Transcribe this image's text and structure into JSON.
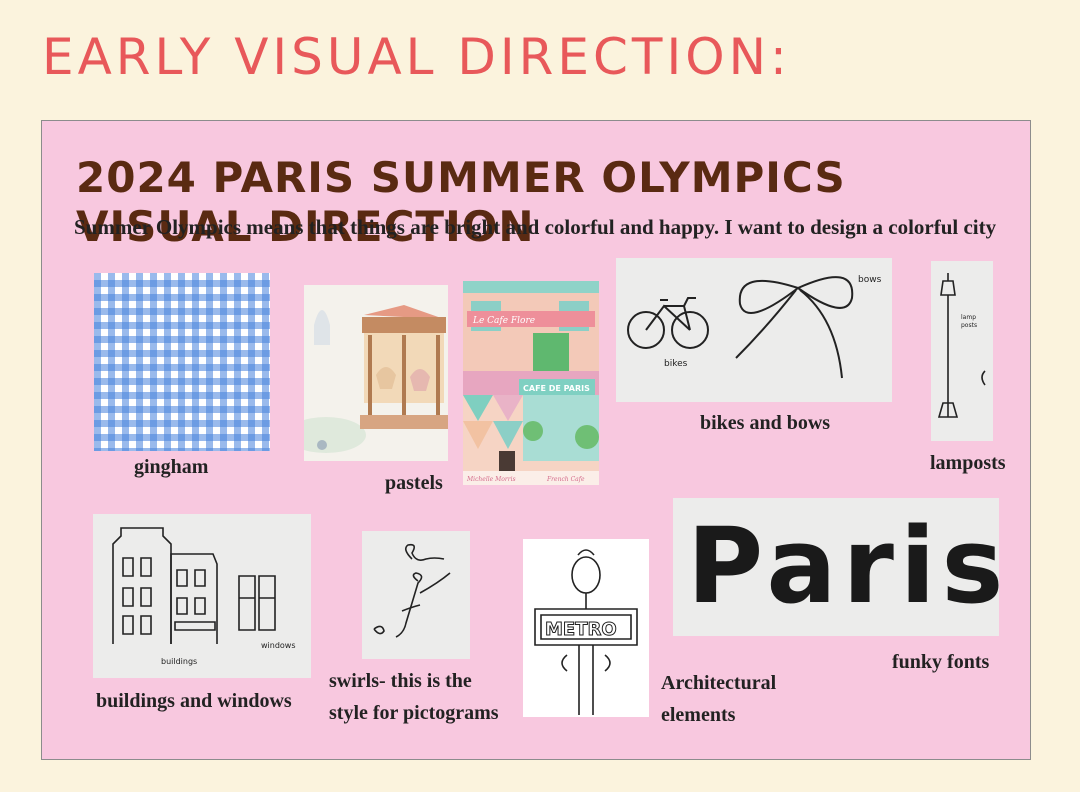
{
  "header": {
    "title": "EARLY VISUAL DIRECTION:"
  },
  "board": {
    "title": "2024 PARIS SUMMER OLYMPICS VISUAL DIRECTION",
    "subtitle": "Summer Olympics means that things are bright and colorful and happy. I want to design a colorful city"
  },
  "captions": {
    "gingham": "gingham",
    "pastels": "pastels",
    "bikes_bows": "bikes and bows",
    "lamposts": "lamposts",
    "buildings": "buildings and windows",
    "swirls_line1": "swirls- this is the",
    "swirls_line2": "style for pictograms",
    "arch_line1": "Architectural",
    "arch_line2": "elements",
    "fonts": "funky fonts"
  },
  "sketch_labels": {
    "bows": "bows",
    "bikes": "bikes",
    "lamp": "lamp",
    "posts": "posts",
    "buildings": "buildings",
    "windows": "windows",
    "metro": "METRO",
    "cafe_flore": "Le Cafe Flore",
    "cafe_paris": "CAFE DE PARIS",
    "signature": "Michelle Morris",
    "french_cafe": "French Cafe",
    "paris": "Paris"
  },
  "colors": {
    "title": "#e8585a",
    "board_bg": "#f8c8df",
    "board_title": "#5a2a12",
    "page_bg": "#fbf3dd"
  }
}
